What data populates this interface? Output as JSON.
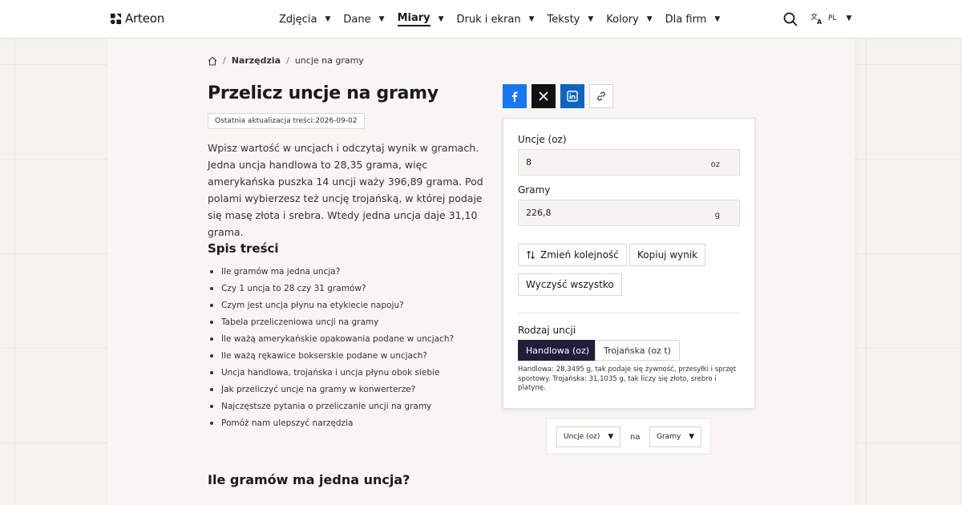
{
  "header": {
    "logo_text": "Arteon",
    "nav": [
      {
        "label": "Zdjęcia",
        "active": false
      },
      {
        "label": "Dane",
        "active": false
      },
      {
        "label": "Miary",
        "active": true
      },
      {
        "label": "Druk i ekran",
        "active": false
      },
      {
        "label": "Teksty",
        "active": false
      },
      {
        "label": "Kolory",
        "active": false
      },
      {
        "label": "Dla firm",
        "active": false
      }
    ],
    "language": "PL"
  },
  "breadcrumb": {
    "parent": "Narzędzia",
    "current": "uncje na gramy"
  },
  "page": {
    "title": "Przelicz uncje na gramy",
    "updated": "Ostatnia aktualizacja treści:2026-09-02",
    "intro": "Wpisz wartość w uncjach i odczytaj wynik w gramach. Jedna uncja handlowa to 28,35 grama, więc amerykańska puszka 14 uncji waży 396,89 grama. Pod polami wybierzesz też uncję trojańską, w której podaje się masę złota i srebra. Wtedy jedna uncja daje 31,10 grama.",
    "toc_title": "Spis treści",
    "toc": [
      "Ile gramów ma jedna uncja?",
      "Czy 1 uncja to 28 czy 31 gramów?",
      "Czym jest uncja płynu na etykiecie napoju?",
      "Tabela przeliczeniowa uncji na gramy",
      "Ile ważą amerykańskie opakowania podane w uncjach?",
      "Ile ważą rękawice bokserskie podane w uncjach?",
      "Uncja handlowa, trojańska i uncja płynu obok siebie",
      "Jak przeliczyć uncje na gramy w konwerterze?",
      "Najczęstsze pytania o przeliczanie uncji na gramy",
      "Pomóż nam ulepszyć narzędzia"
    ],
    "section_title": "Ile gramów ma jedna uncja?"
  },
  "converter": {
    "from_label": "Uncje (oz)",
    "from_value": "8",
    "from_unit": "oz",
    "to_label": "Gramy",
    "to_value": "226,8",
    "to_unit": "g",
    "swap_label": "Zmień kolejność",
    "copy_label": "Kopiuj wynik",
    "clear_label": "Wyczyść wszystko",
    "unit_type_label": "Rodzaj uncji",
    "unit_type_options": [
      "Handlowa (oz)",
      "Trojańska (oz t)"
    ],
    "unit_type_selected": "Handlowa (oz)",
    "note": "Handlowa: 28,3495 g, tak podaje się żywność, przesyłki i sprzęt sportowy. Trojańska: 31,1035 g, tak liczy się złoto, srebro i platynę."
  },
  "selector": {
    "from": "Uncje (oz)",
    "connector": "na",
    "to": "Gramy"
  },
  "colors": {
    "facebook": "#1877f2",
    "x": "#111111",
    "linkedin": "#0a66c2",
    "selected_segment": "#1f1f3a"
  }
}
